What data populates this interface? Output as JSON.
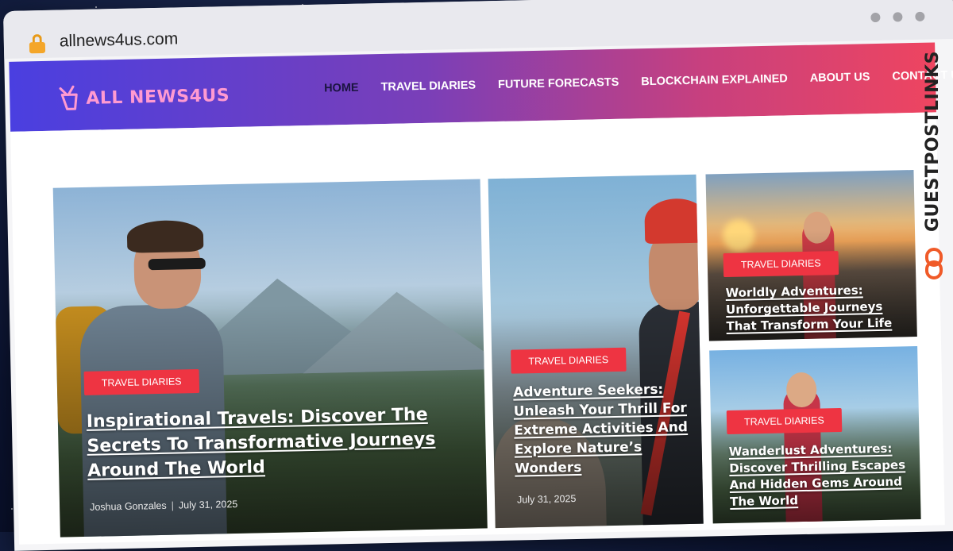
{
  "browser": {
    "url": "allnews4us.com"
  },
  "site": {
    "logo_text": "ALL NEWS4US",
    "nav": [
      {
        "label": "HOME",
        "active": true
      },
      {
        "label": "TRAVEL DIARIES",
        "active": false
      },
      {
        "label": "FUTURE FORECASTS",
        "active": false
      },
      {
        "label": "BLOCKCHAIN EXPLAINED",
        "active": false
      },
      {
        "label": "ABOUT US",
        "active": false
      },
      {
        "label": "CONTACT US",
        "active": false
      }
    ]
  },
  "posts": [
    {
      "category": "TRAVEL DIARIES",
      "title": "Inspirational Travels: Discover The Secrets To Transformative Journeys Around The World",
      "author": "Joshua Gonzales",
      "date": "July 31, 2025"
    },
    {
      "category": "TRAVEL DIARIES",
      "title": "Adventure Seekers: Unleash Your Thrill For Extreme Activities And Explore Nature’s Wonders",
      "date": "July 31, 2025"
    },
    {
      "category": "TRAVEL DIARIES",
      "title": "Worldly Adventures: Unforgettable Journeys That Transform Your Life"
    },
    {
      "category": "TRAVEL DIARIES",
      "title": "Wanderlust Adventures: Discover Thrilling Escapes And Hidden Gems Around The World"
    }
  ],
  "watermark": {
    "text": "GUESTPOSTLINKS"
  },
  "colors": {
    "header_gradient": [
      "#4a3fe0",
      "#7a3fb8",
      "#c8407e",
      "#ee4560"
    ],
    "badge": "#ee3442",
    "logo": "#ff9ad1",
    "lock": "#f4a62a",
    "watermark_accent": "#f05a28"
  }
}
